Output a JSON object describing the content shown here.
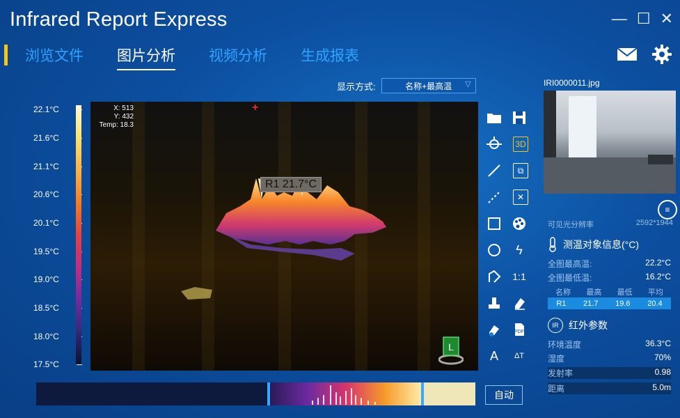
{
  "app": {
    "title": "Infrared Report Express",
    "window_controls": [
      "—",
      "☐",
      "✕"
    ]
  },
  "tabs": [
    {
      "label": "浏览文件",
      "active": false
    },
    {
      "label": "图片分析",
      "active": true
    },
    {
      "label": "视频分析",
      "active": false
    },
    {
      "label": "生成报表",
      "active": false
    }
  ],
  "top_icons": [
    "mail-icon",
    "gear-icon"
  ],
  "display_mode": {
    "label": "显示方式:",
    "value": "名称+最高温"
  },
  "scale": {
    "labels": [
      "22.1°C",
      "21.6°C",
      "21.1°C",
      "20.6°C",
      "20.1°C",
      "19.5°C",
      "19.0°C",
      "18.5°C",
      "18.0°C",
      "17.5°C"
    ]
  },
  "viewport": {
    "readout": {
      "x": "X: 513",
      "y": "Y: 432",
      "temp": "Temp: 18.3"
    },
    "roi_label": "R1  21.7°C",
    "cube_label": "L"
  },
  "toolbar": {
    "icons": [
      "folder-icon",
      "save-icon",
      "point-icon",
      "3d-icon",
      "line-icon",
      "copy-icon",
      "dashed-line-icon",
      "clear-icon",
      "rectangle-icon",
      "palette-icon",
      "circle-icon",
      "flash-icon",
      "polygon-icon",
      "ratio-icon",
      "stamp-icon",
      "eraser-icon",
      "erase-all-icon",
      "export-icon",
      "text-icon",
      "text-size-icon"
    ],
    "labels": {
      "3d": "3D",
      "ratio": "1:1",
      "text": "A",
      "text_size": "ΔT"
    }
  },
  "histogram": {
    "auto_label": "自动"
  },
  "panel": {
    "filename": "IRI0000011.jpg",
    "resolution_label": "可见光分辨率",
    "resolution_value": "2592*1944",
    "measure_header": "测温对象信息(°C)",
    "max_label": "全图最高温:",
    "max_value": "22.2°C",
    "min_label": "全图最低温:",
    "min_value": "16.2°C",
    "table_headers": [
      "名称",
      "最高",
      "最低",
      "平均"
    ],
    "table_rows": [
      [
        "R1",
        "21.7",
        "19.6",
        "20.4"
      ]
    ],
    "ir_header": "红外参数",
    "ir_badge": "IR",
    "params": [
      {
        "label": "环境温度",
        "value": "36.3°C"
      },
      {
        "label": "湿度",
        "value": "70%"
      },
      {
        "label": "发射率",
        "value": "0.98"
      },
      {
        "label": "距离",
        "value": "5.0m"
      }
    ]
  },
  "colors": {
    "accent": "#f4c51b",
    "tab_inactive": "#2fa3ff",
    "background": "#0c4fa0"
  }
}
